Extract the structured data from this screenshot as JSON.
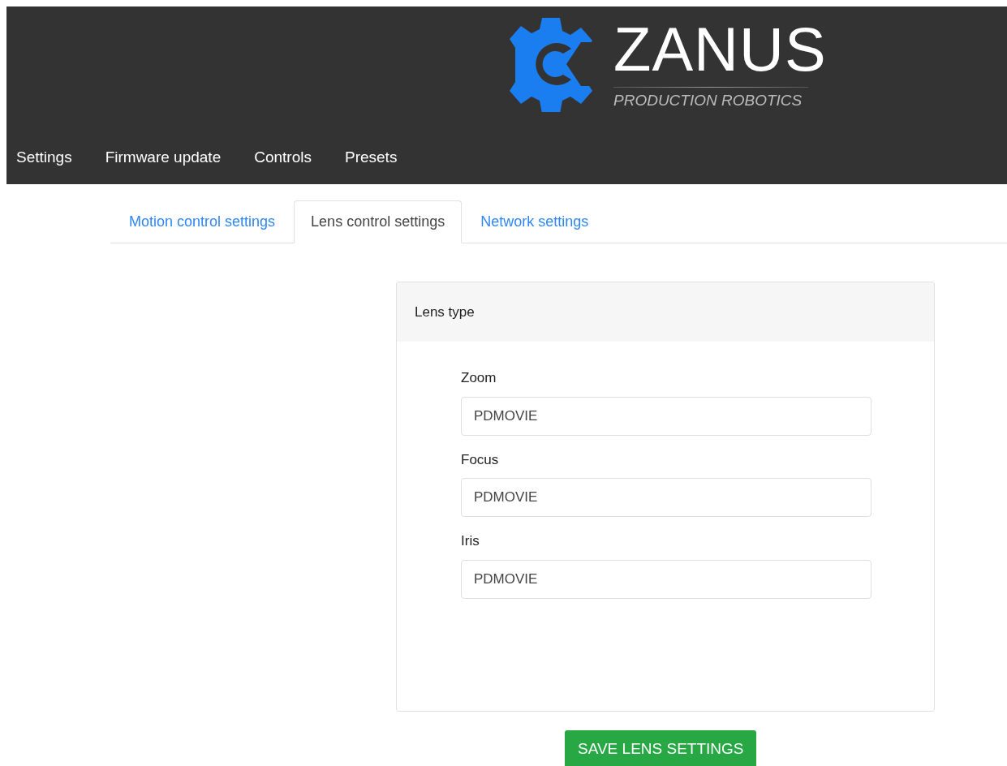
{
  "logo": {
    "name": "ZANUS",
    "tagline": "PRODUCTION ROBOTICS"
  },
  "nav": [
    "Settings",
    "Firmware update",
    "Controls",
    "Presets"
  ],
  "tabs": [
    {
      "label": "Motion control settings",
      "selected": false
    },
    {
      "label": "Lens control settings",
      "selected": true
    },
    {
      "label": "Network settings",
      "selected": false
    }
  ],
  "card": {
    "title": "Lens type",
    "fields": [
      {
        "label": "Zoom",
        "value": "PDMOVIE"
      },
      {
        "label": "Focus",
        "value": "PDMOVIE"
      },
      {
        "label": "Iris",
        "value": "PDMOVIE"
      }
    ]
  },
  "save_button": "SAVE LENS SETTINGS"
}
